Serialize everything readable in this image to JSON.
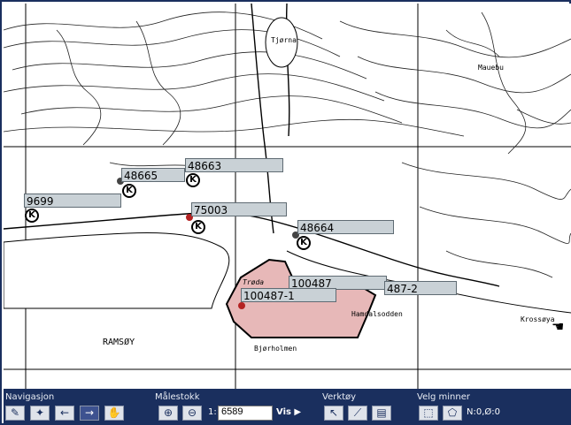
{
  "map": {
    "labels": [
      "48665",
      "48663",
      "9699",
      "75003",
      "48664",
      "100487",
      "100487-1",
      "487-2"
    ],
    "pin_glyph": "K",
    "place_names": [
      "Trøda",
      "Tjørna",
      "RAMSØY",
      "Bjørholmen",
      "Hamdalsodden",
      "Krossøya",
      "Mauebu"
    ],
    "area_fill": "#e7b8b8",
    "area_stroke": "#000000",
    "cursor_icon": "hand-cursor-icon"
  },
  "toolbar": {
    "navigation_label": "Navigasjon",
    "scale_label": "Målestokk",
    "tools_label": "Verktøy",
    "select_label": "Velg minner",
    "scale_prefix": "1:",
    "scale_value": "6589",
    "show_label": "Vis",
    "coords": "N:0,Ø:0",
    "nav_icons": [
      "pen-icon",
      "pin-icon",
      "back-arrow-icon",
      "forward-arrow-icon",
      "hand-icon"
    ],
    "zoom_icons": [
      "zoom-in-icon",
      "zoom-out-icon"
    ],
    "tool_icons": [
      "select-arrow-icon",
      "ruler-icon",
      "list-icon"
    ],
    "select_icons": [
      "rect-select-icon",
      "poly-select-icon"
    ],
    "bg_color": "#1a2f5e"
  }
}
